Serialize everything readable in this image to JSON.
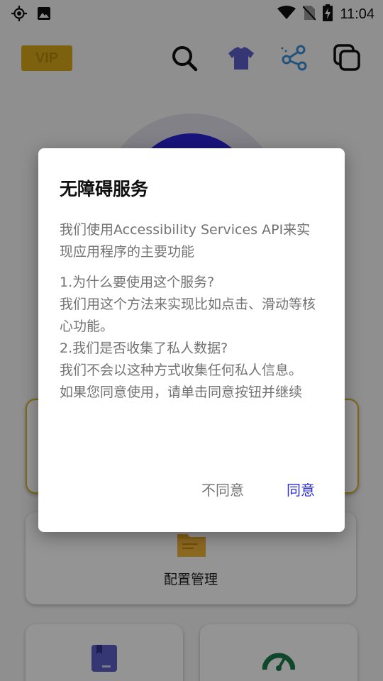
{
  "status_bar": {
    "time": "11:04",
    "icons": [
      "gps-icon",
      "image-notification-icon",
      "wifi-icon",
      "no-sim-icon",
      "battery-charging-icon"
    ]
  },
  "top_bar": {
    "vip_label": "VIP",
    "icons": [
      "search-icon",
      "shirt-icon",
      "share-icon",
      "multi-window-icon"
    ]
  },
  "cards": {
    "config_label": "配置管理"
  },
  "dialog": {
    "title": "无障碍服务",
    "intro": "我们使用Accessibility Services API来实现应用程序的主要功能",
    "q1": "1.为什么要使用这个服务?",
    "a1": "我们用这个方法来实现比如点击、滑动等核心功能。",
    "q2": "2.我们是否收集了私人数据?",
    "a2": "我们不会以这种方式收集任何私人信息。",
    "consent": "如果您同意使用，请单击同意按钮并继续",
    "disagree_label": "不同意",
    "agree_label": "同意"
  },
  "colors": {
    "accent": "#2c2ed3",
    "vip": "#d9a81a"
  }
}
